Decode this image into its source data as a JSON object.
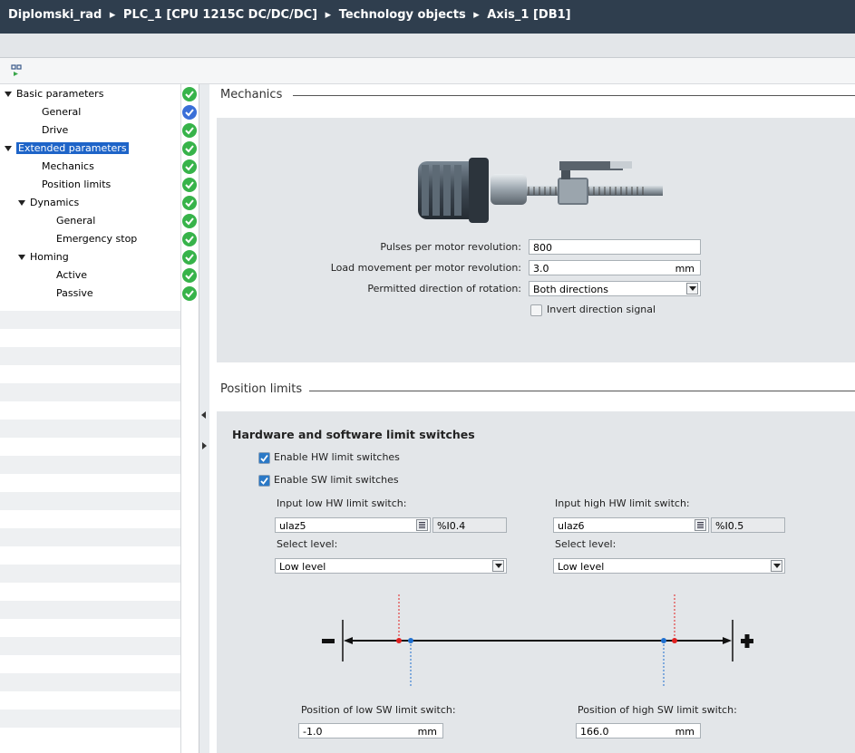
{
  "breadcrumb": [
    "Diplomski_rad",
    "PLC_1 [CPU 1215C DC/DC/DC]",
    "Technology objects",
    "Axis_1 [DB1]"
  ],
  "breadcrumb_sep": "▸",
  "tree": {
    "basic": "Basic parameters",
    "general": "General",
    "drive": "Drive",
    "extended": "Extended parameters",
    "mechanics": "Mechanics",
    "position_limits": "Position limits",
    "dynamics": "Dynamics",
    "dyn_general": "General",
    "emergency_stop": "Emergency stop",
    "homing": "Homing",
    "active": "Active",
    "passive": "Passive"
  },
  "mechanics": {
    "title": "Mechanics",
    "pulses_label": "Pulses per motor revolution:",
    "pulses_value": "800",
    "load_label": "Load movement per motor revolution:",
    "load_value": "3.0",
    "load_unit": "mm",
    "direction_label": "Permitted direction of rotation:",
    "direction_value": "Both directions",
    "invert_label": "Invert direction signal",
    "invert_checked": false
  },
  "position_limits": {
    "title": "Position limits",
    "hw_sw_title": "Hardware and software limit switches",
    "enable_hw_label": "Enable HW limit switches",
    "enable_hw_checked": true,
    "enable_sw_label": "Enable SW limit switches",
    "enable_sw_checked": true,
    "low_hw_label": "Input low HW limit switch:",
    "low_hw_tag": "ulaz5",
    "low_hw_address": "%I0.4",
    "high_hw_label": "Input high HW limit switch:",
    "high_hw_tag": "ulaz6",
    "high_hw_address": "%I0.5",
    "select_level_label": "Select level:",
    "low_level_value": "Low level",
    "high_level_value": "Low level",
    "low_sw_label": "Position of low SW limit switch:",
    "low_sw_value": "-1.0",
    "high_sw_label": "Position of high SW limit switch:",
    "high_sw_value": "166.0",
    "unit": "mm",
    "minus": "−",
    "plus": "+"
  },
  "colors": {
    "titlebar": "#2f3e4e",
    "panel": "#e3e6e9",
    "status_ok": "#37b34a",
    "status_info": "#3a6fd8",
    "selection": "#1e64c8",
    "hw_marker": "#e02020",
    "sw_marker": "#1e6fd0"
  }
}
